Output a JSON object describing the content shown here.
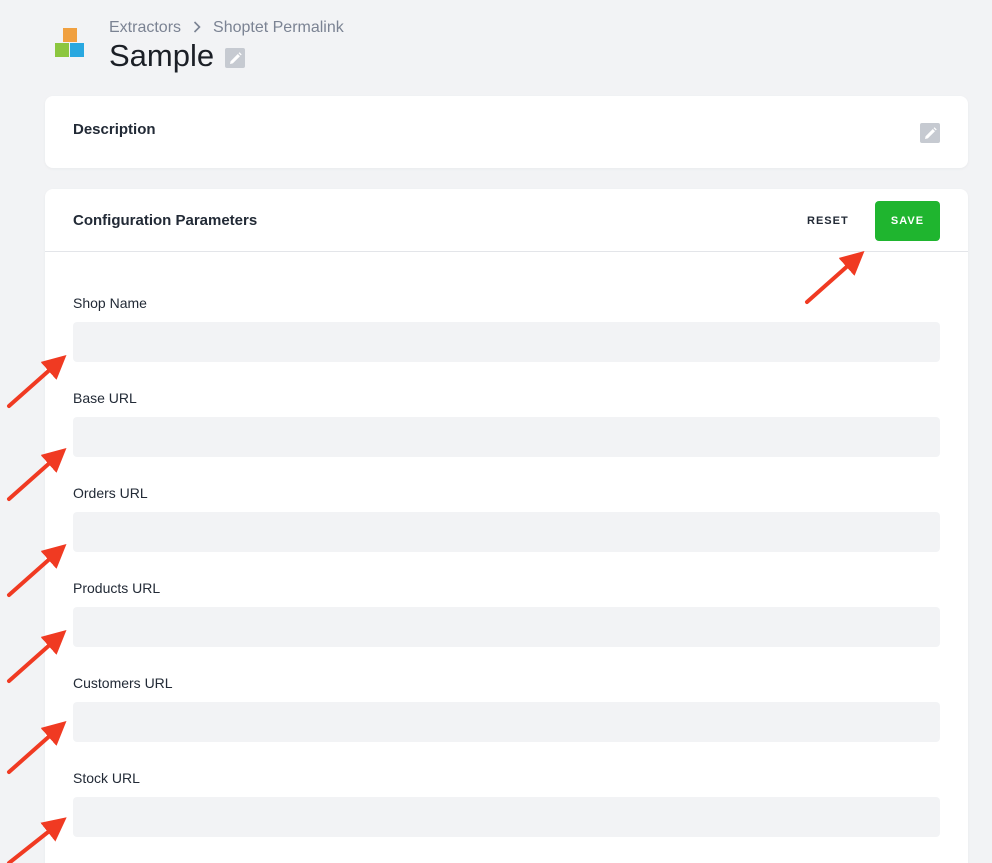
{
  "breadcrumb": {
    "parent": "Extractors",
    "separator": ">",
    "current": "Shoptet Permalink"
  },
  "page": {
    "title": "Sample"
  },
  "description_card": {
    "label": "Description"
  },
  "config_card": {
    "title": "Configuration Parameters",
    "reset_label": "RESET",
    "save_label": "SAVE",
    "fields": [
      {
        "label": "Shop Name",
        "value": ""
      },
      {
        "label": "Base URL",
        "value": ""
      },
      {
        "label": "Orders URL",
        "value": ""
      },
      {
        "label": "Products URL",
        "value": ""
      },
      {
        "label": "Customers URL",
        "value": ""
      },
      {
        "label": "Stock URL",
        "value": ""
      }
    ]
  },
  "icons": {
    "logo": "stacked-squares-logo-icon",
    "edit": "pencil-icon",
    "annotation": "red-arrow-icon"
  },
  "colors": {
    "save_button": "#1fb52f",
    "annotation_arrow": "#f03a22",
    "background": "#f2f3f5",
    "input_background": "#f2f3f5"
  }
}
